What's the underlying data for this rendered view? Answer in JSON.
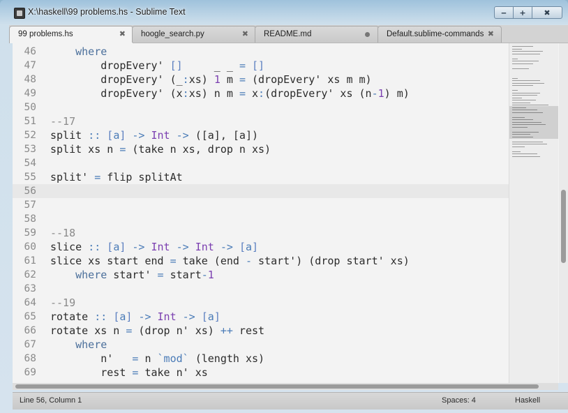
{
  "window": {
    "title": "X:\\haskell\\99 problems.hs - Sublime Text"
  },
  "tabs": [
    {
      "label": "99 problems.hs",
      "active": true,
      "close": "✖"
    },
    {
      "label": "hoogle_search.py",
      "active": false,
      "close": "✖"
    },
    {
      "label": "README.md",
      "active": false,
      "dirty": true
    },
    {
      "label": "Default.sublime-commands",
      "active": false,
      "close": "✖"
    }
  ],
  "editor": {
    "current_line": 56,
    "lines": [
      {
        "n": "46",
        "tokens": [
          [
            "    ",
            ""
          ],
          [
            "where",
            "kw"
          ]
        ]
      },
      {
        "n": "47",
        "tokens": [
          [
            "        dropEvery' ",
            ""
          ],
          [
            "[]",
            "br"
          ],
          [
            "     _ _ ",
            ""
          ],
          [
            "=",
            "op"
          ],
          [
            " ",
            ""
          ],
          [
            "[]",
            "br"
          ]
        ]
      },
      {
        "n": "48",
        "tokens": [
          [
            "        dropEvery' (_",
            ""
          ],
          [
            ":",
            "op"
          ],
          [
            "xs) ",
            ""
          ],
          [
            "1",
            "num"
          ],
          [
            " m ",
            ""
          ],
          [
            "=",
            "op"
          ],
          [
            " (dropEvery' xs m m)",
            ""
          ]
        ]
      },
      {
        "n": "49",
        "tokens": [
          [
            "        dropEvery' (x",
            ""
          ],
          [
            ":",
            "op"
          ],
          [
            "xs) n m ",
            ""
          ],
          [
            "=",
            "op"
          ],
          [
            " x",
            ""
          ],
          [
            ":",
            "op"
          ],
          [
            "(dropEvery' xs (n",
            ""
          ],
          [
            "-",
            "op"
          ],
          [
            "1",
            "num"
          ],
          [
            ") m)",
            ""
          ]
        ]
      },
      {
        "n": "50",
        "tokens": []
      },
      {
        "n": "51",
        "tokens": [
          [
            "--17",
            "cm"
          ]
        ]
      },
      {
        "n": "52",
        "tokens": [
          [
            "split ",
            ""
          ],
          [
            "::",
            "op"
          ],
          [
            " ",
            ""
          ],
          [
            "[",
            "br"
          ],
          [
            "a",
            "op"
          ],
          [
            "]",
            "br"
          ],
          [
            " ",
            ""
          ],
          [
            "->",
            "op"
          ],
          [
            " ",
            ""
          ],
          [
            "Int",
            "ty"
          ],
          [
            " ",
            ""
          ],
          [
            "->",
            "op"
          ],
          [
            " ([a], [a])",
            ""
          ]
        ]
      },
      {
        "n": "53",
        "tokens": [
          [
            "split xs n ",
            ""
          ],
          [
            "=",
            "op"
          ],
          [
            " (take n xs, drop n xs)",
            ""
          ]
        ]
      },
      {
        "n": "54",
        "tokens": []
      },
      {
        "n": "55",
        "tokens": [
          [
            "split' ",
            ""
          ],
          [
            "=",
            "op"
          ],
          [
            " flip splitAt",
            ""
          ]
        ]
      },
      {
        "n": "56",
        "tokens": []
      },
      {
        "n": "57",
        "tokens": []
      },
      {
        "n": "58",
        "tokens": []
      },
      {
        "n": "59",
        "tokens": [
          [
            "--18",
            "cm"
          ]
        ]
      },
      {
        "n": "60",
        "tokens": [
          [
            "slice ",
            ""
          ],
          [
            "::",
            "op"
          ],
          [
            " ",
            ""
          ],
          [
            "[",
            "br"
          ],
          [
            "a",
            "op"
          ],
          [
            "]",
            "br"
          ],
          [
            " ",
            ""
          ],
          [
            "->",
            "op"
          ],
          [
            " ",
            ""
          ],
          [
            "Int",
            "ty"
          ],
          [
            " ",
            ""
          ],
          [
            "->",
            "op"
          ],
          [
            " ",
            ""
          ],
          [
            "Int",
            "ty"
          ],
          [
            " ",
            ""
          ],
          [
            "->",
            "op"
          ],
          [
            " ",
            ""
          ],
          [
            "[",
            "br"
          ],
          [
            "a",
            "op"
          ],
          [
            "]",
            "br"
          ]
        ]
      },
      {
        "n": "61",
        "tokens": [
          [
            "slice xs start end ",
            ""
          ],
          [
            "=",
            "op"
          ],
          [
            " take (end ",
            ""
          ],
          [
            "-",
            "op"
          ],
          [
            " start') (drop start' xs)",
            ""
          ]
        ]
      },
      {
        "n": "62",
        "tokens": [
          [
            "    ",
            ""
          ],
          [
            "where",
            "kw"
          ],
          [
            " start' ",
            ""
          ],
          [
            "=",
            "op"
          ],
          [
            " start",
            ""
          ],
          [
            "-",
            "op"
          ],
          [
            "1",
            "num"
          ]
        ]
      },
      {
        "n": "63",
        "tokens": []
      },
      {
        "n": "64",
        "tokens": [
          [
            "--19",
            "cm"
          ]
        ]
      },
      {
        "n": "65",
        "tokens": [
          [
            "rotate ",
            ""
          ],
          [
            "::",
            "op"
          ],
          [
            " ",
            ""
          ],
          [
            "[",
            "br"
          ],
          [
            "a",
            "op"
          ],
          [
            "]",
            "br"
          ],
          [
            " ",
            ""
          ],
          [
            "->",
            "op"
          ],
          [
            " ",
            ""
          ],
          [
            "Int",
            "ty"
          ],
          [
            " ",
            ""
          ],
          [
            "->",
            "op"
          ],
          [
            " ",
            ""
          ],
          [
            "[",
            "br"
          ],
          [
            "a",
            "op"
          ],
          [
            "]",
            "br"
          ]
        ]
      },
      {
        "n": "66",
        "tokens": [
          [
            "rotate xs n ",
            ""
          ],
          [
            "=",
            "op"
          ],
          [
            " (drop n' xs) ",
            ""
          ],
          [
            "++",
            "op"
          ],
          [
            " rest",
            ""
          ]
        ]
      },
      {
        "n": "67",
        "tokens": [
          [
            "    ",
            ""
          ],
          [
            "where",
            "kw"
          ]
        ]
      },
      {
        "n": "68",
        "tokens": [
          [
            "        n'   ",
            ""
          ],
          [
            "=",
            "op"
          ],
          [
            " n ",
            ""
          ],
          [
            "`mod`",
            "op"
          ],
          [
            " (length xs)",
            ""
          ]
        ]
      },
      {
        "n": "69",
        "tokens": [
          [
            "        rest ",
            ""
          ],
          [
            "=",
            "op"
          ],
          [
            " take n' xs",
            ""
          ]
        ]
      }
    ]
  },
  "status": {
    "position": "Line 56, Column 1",
    "spaces": "Spaces: 4",
    "syntax": "Haskell"
  },
  "colors": {
    "keyword": "#4b6f9b",
    "type": "#7b3fb0",
    "operator": "#4a7bb7",
    "comment": "#8a8a8a",
    "background": "#f3f3f3"
  }
}
